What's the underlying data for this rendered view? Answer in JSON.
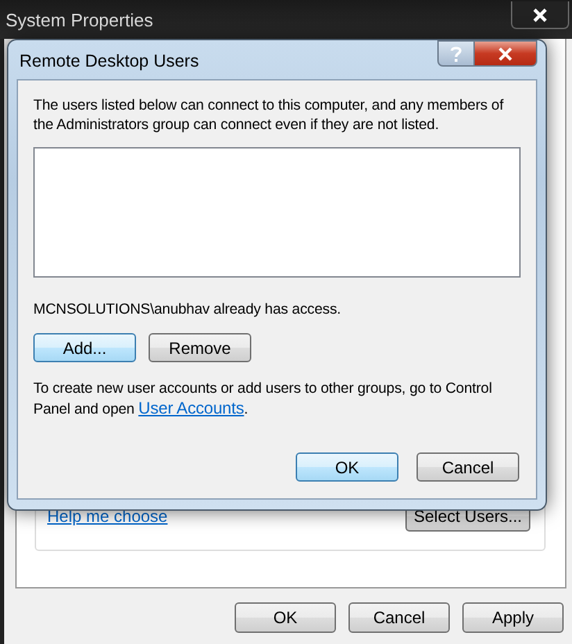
{
  "window": {
    "title": "System Properties"
  },
  "remote_access": {
    "help_link": "Help me choose",
    "select_users_button": "Select Users..."
  },
  "buttons": [
    {
      "label": "OK",
      "highlighted": false
    },
    {
      "label": "Cancel",
      "highlighted": false
    },
    {
      "label": "Apply",
      "highlighted": false
    }
  ],
  "dialog": {
    "title": "Remote Desktop Users",
    "description": "The users listed below can connect to this computer, and any members of the Administrators group can connect even if they are not listed.",
    "status": "MCNSOLUTIONS\\anubhav already has access.",
    "list_buttons": [
      {
        "label": "Add...",
        "highlighted": true
      },
      {
        "label": "Remove",
        "highlighted": false
      }
    ],
    "info_before": "To create new user accounts or add users to other groups, go to Control Panel and open ",
    "info_link": "User Accounts",
    "info_after": ".",
    "buttons": [
      {
        "label": "OK",
        "highlighted": true
      },
      {
        "label": "Cancel",
        "highlighted": false
      }
    ]
  }
}
